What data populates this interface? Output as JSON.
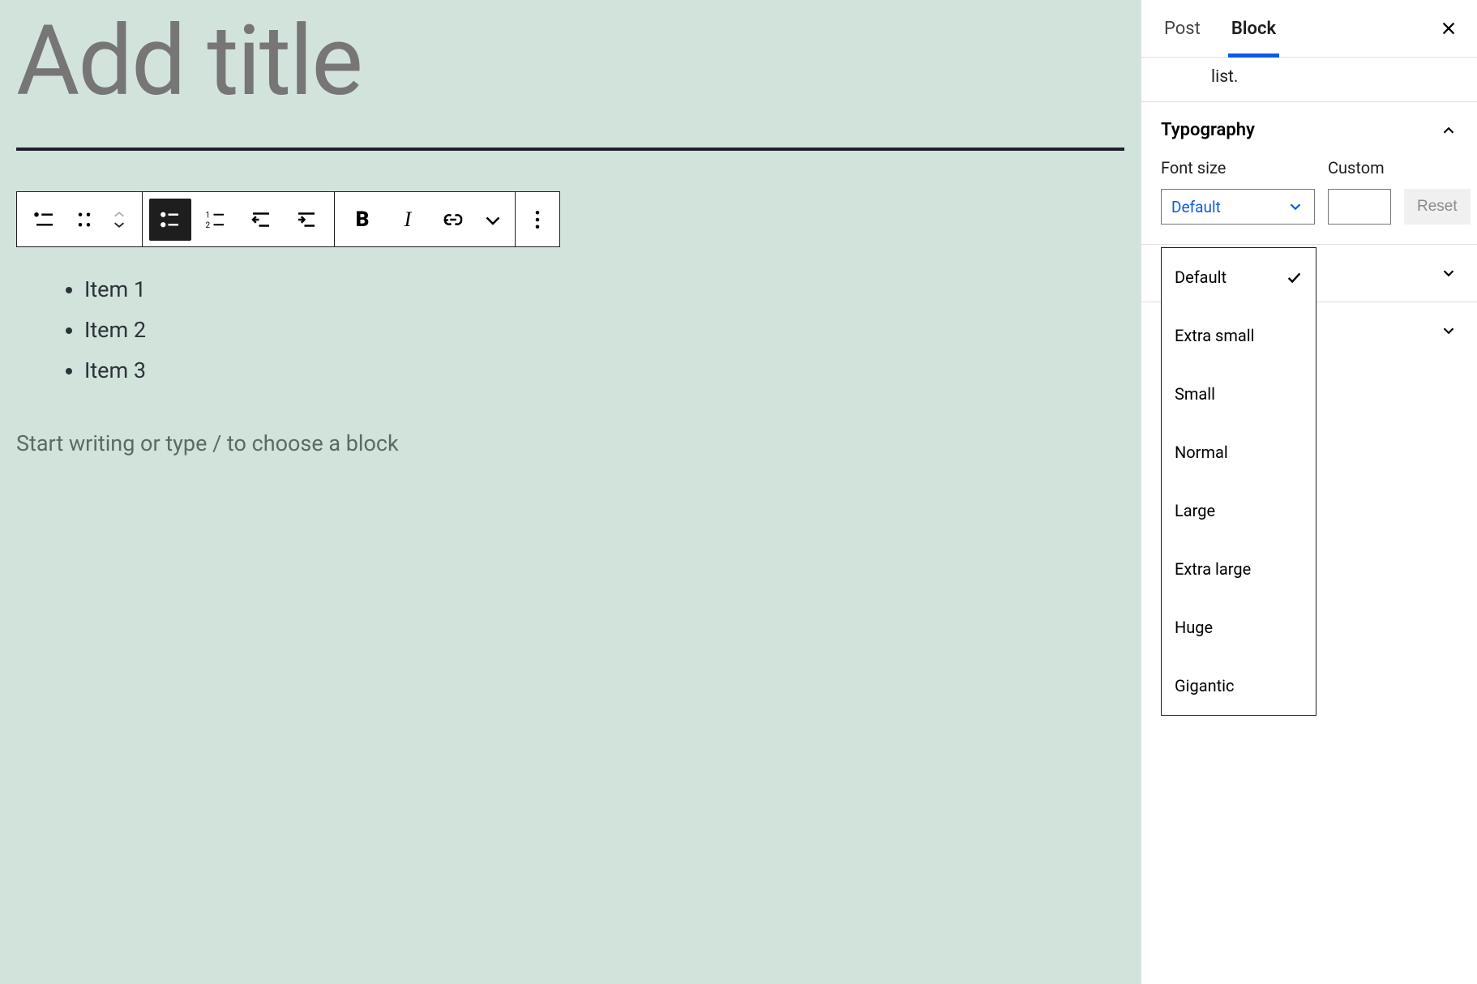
{
  "editor": {
    "title_placeholder": "Add title",
    "list_items": [
      "Item 1",
      "Item 2",
      "Item 3"
    ],
    "prompt": "Start writing or type / to choose a block"
  },
  "sidebar": {
    "tabs": {
      "post": "Post",
      "block": "Block",
      "active": "block"
    },
    "description_fragment": "list.",
    "typography": {
      "title": "Typography",
      "font_size_label": "Font size",
      "custom_label": "Custom",
      "selected": "Default",
      "reset_label": "Reset",
      "options": [
        "Default",
        "Extra small",
        "Small",
        "Normal",
        "Large",
        "Extra large",
        "Huge",
        "Gigantic"
      ]
    }
  }
}
